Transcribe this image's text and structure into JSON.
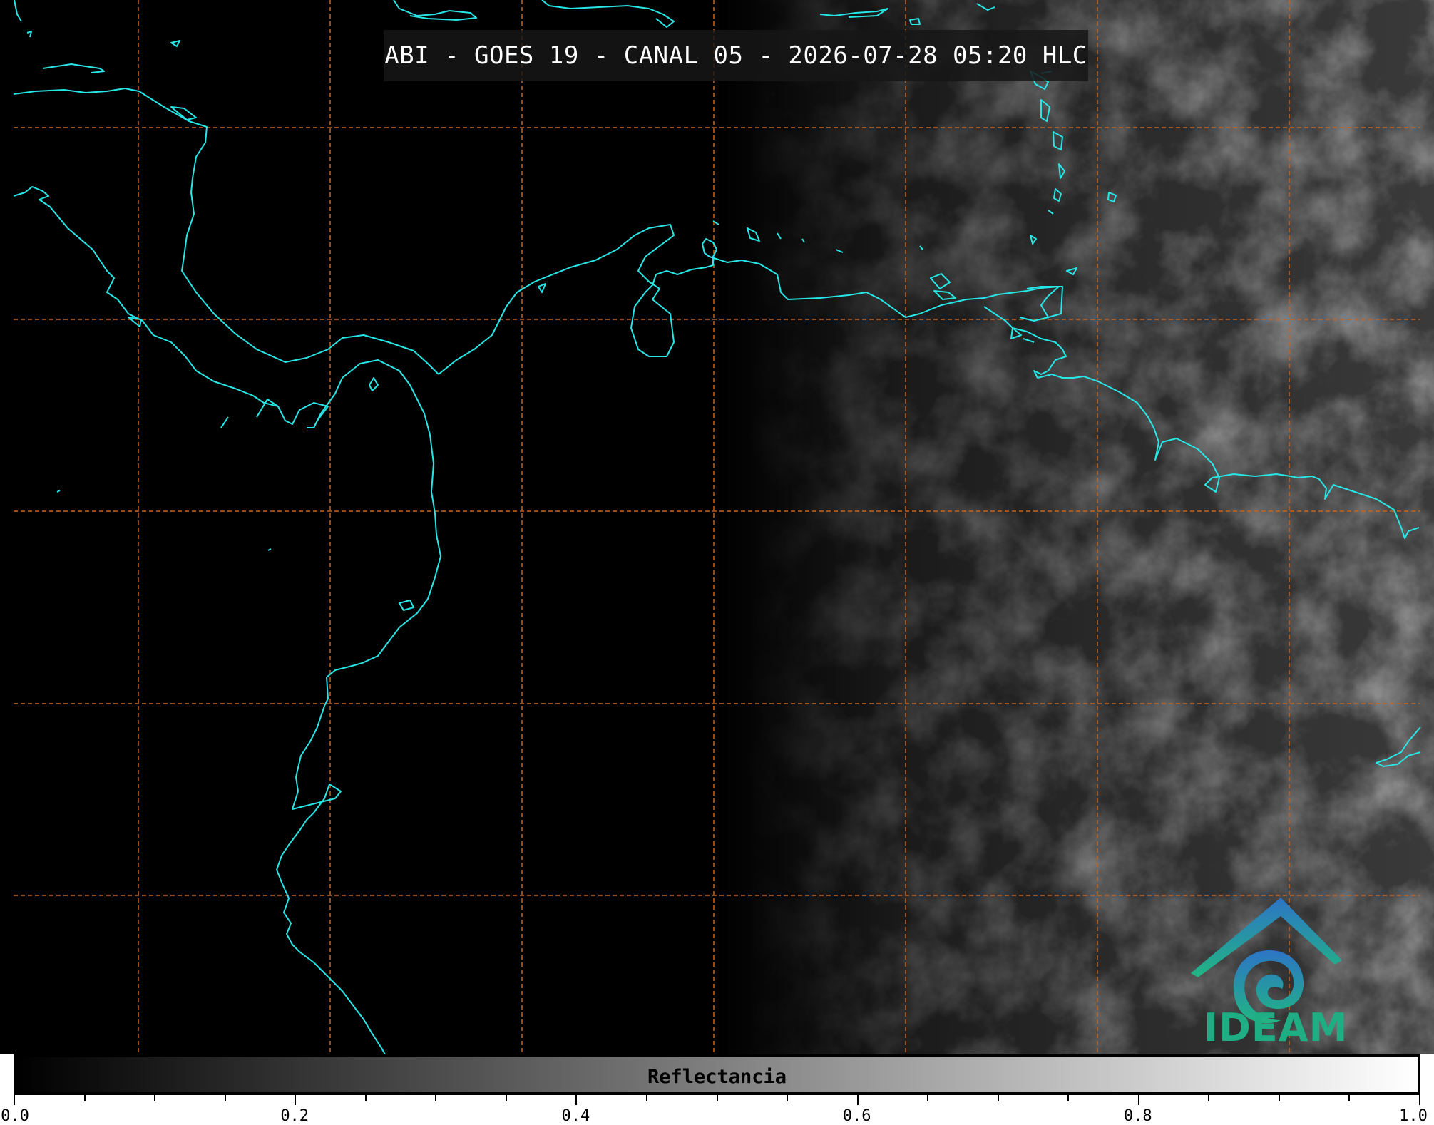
{
  "title": "ABI - GOES 19 - CANAL 05 - 2026-07-28 05:20 HLC",
  "colors": {
    "coastline": "#27e6e6",
    "grid": "#c8641e",
    "background": "#000000"
  },
  "logo": {
    "text": "IDEAM",
    "icon": "ideam-spiral-logo"
  },
  "colorbar": {
    "label": "Reflectancia",
    "min": 0.0,
    "max": 1.0,
    "major_ticks": [
      "0.0",
      "0.2",
      "0.4",
      "0.6",
      "0.8",
      "1.0"
    ],
    "minor_step": 0.05,
    "colormap": [
      "#000000",
      "#ffffff"
    ]
  }
}
